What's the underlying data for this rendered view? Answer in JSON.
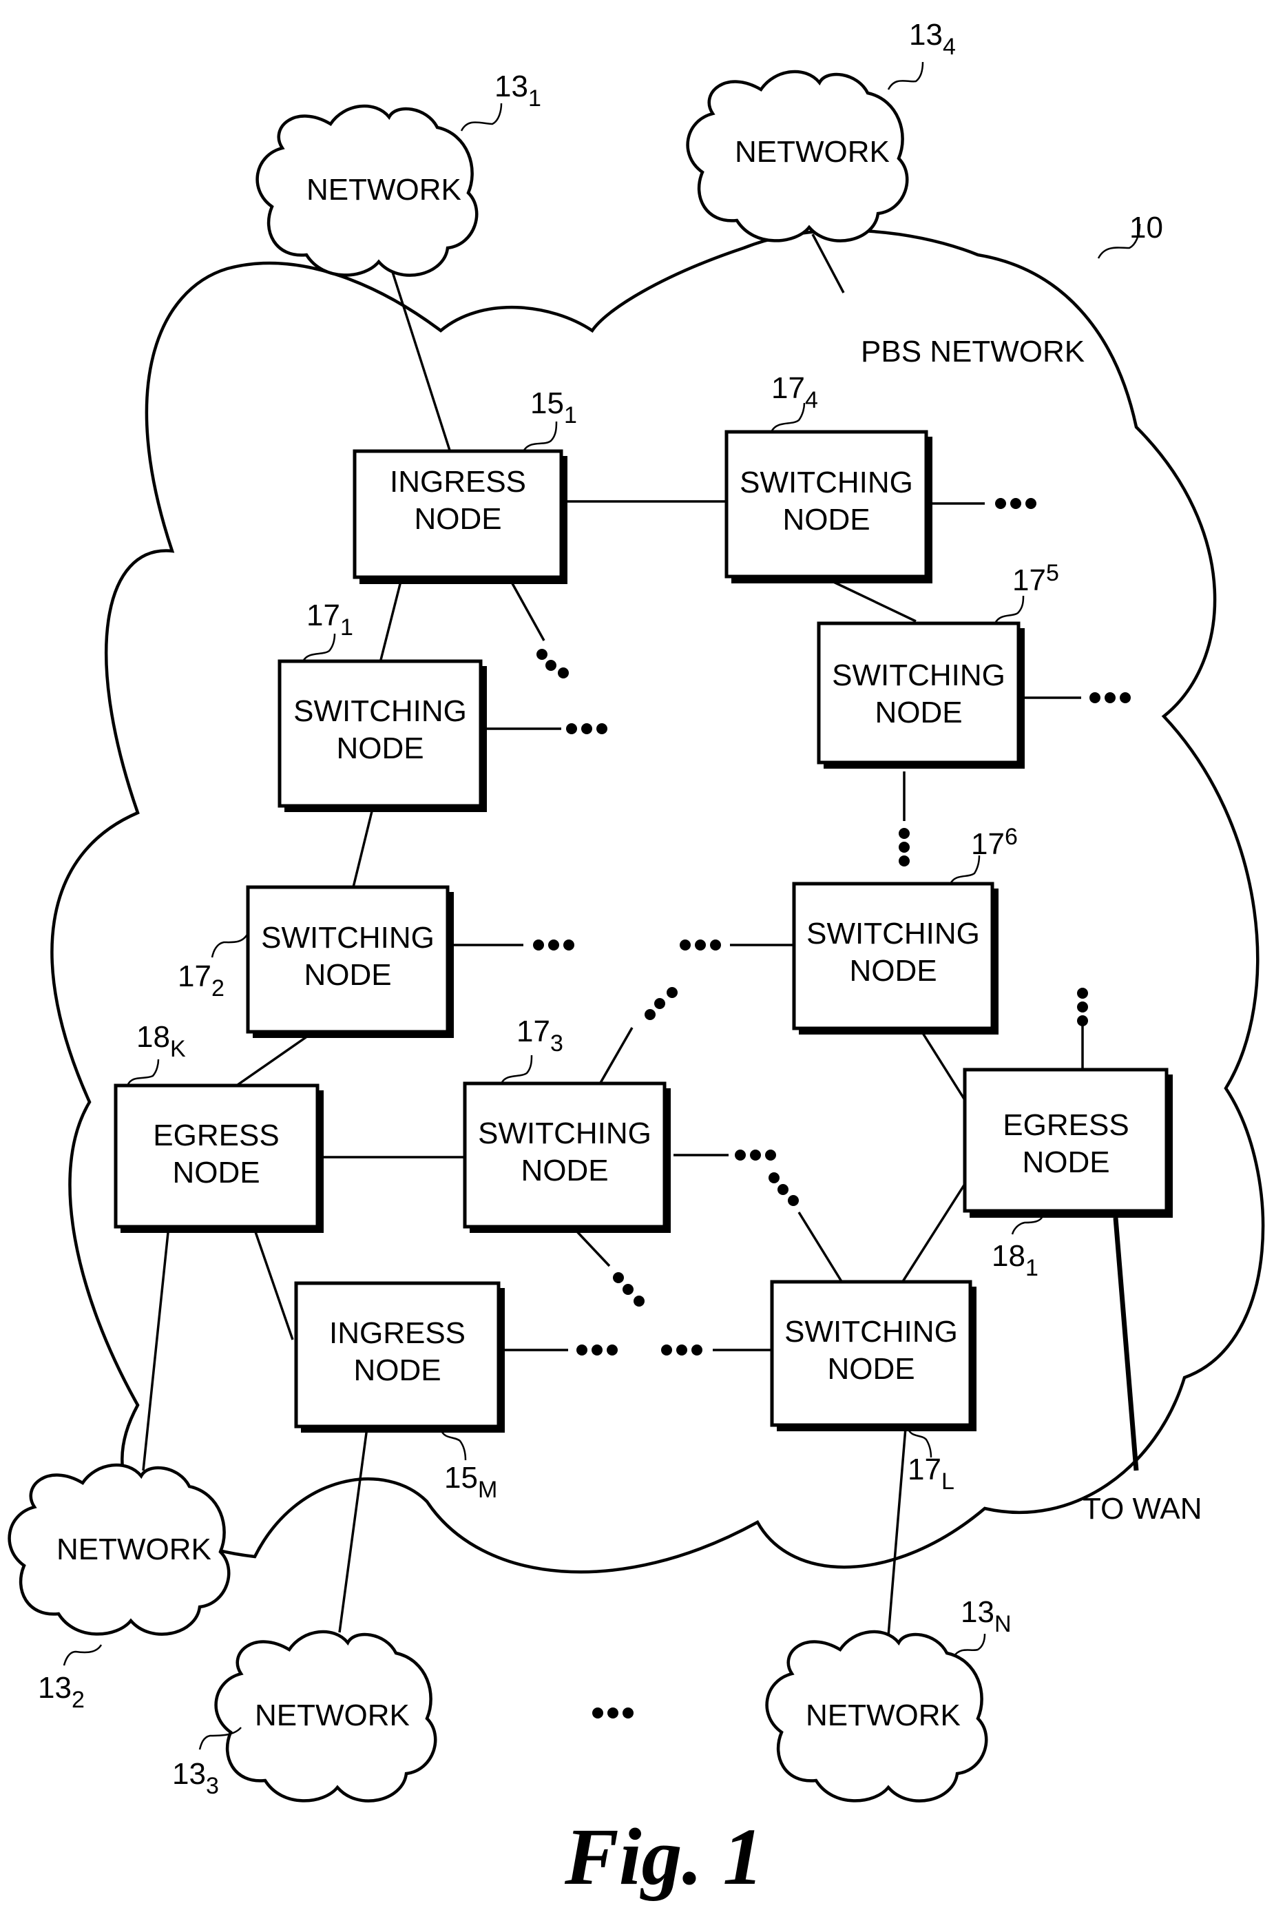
{
  "figure": {
    "caption": "Fig. 1",
    "main_network": {
      "label": "PBS NETWORK",
      "ref": "10"
    }
  },
  "external_networks": [
    {
      "id": "net-13-1",
      "label": "NETWORK",
      "ref_base": "13",
      "ref_sub": "1"
    },
    {
      "id": "net-13-2",
      "label": "NETWORK",
      "ref_base": "13",
      "ref_sub": "2"
    },
    {
      "id": "net-13-3",
      "label": "NETWORK",
      "ref_base": "13",
      "ref_sub": "3"
    },
    {
      "id": "net-13-4",
      "label": "NETWORK",
      "ref_base": "13",
      "ref_sub": "4"
    },
    {
      "id": "net-13-N",
      "label": "NETWORK",
      "ref_base": "13",
      "ref_sub": "N"
    }
  ],
  "nodes": [
    {
      "id": "ingress-15-1",
      "line1": "INGRESS",
      "line2": "NODE",
      "ref_base": "15",
      "ref_sub": "1"
    },
    {
      "id": "switch-17-4",
      "line1": "SWITCHING",
      "line2": "NODE",
      "ref_base": "17",
      "ref_sub": "4"
    },
    {
      "id": "switch-17-5",
      "line1": "SWITCHING",
      "line2": "NODE",
      "ref_base": "17",
      "ref_sub": "5"
    },
    {
      "id": "switch-17-1",
      "line1": "SWITCHING",
      "line2": "NODE",
      "ref_base": "17",
      "ref_sub": "1"
    },
    {
      "id": "switch-17-2",
      "line1": "SWITCHING",
      "line2": "NODE",
      "ref_base": "17",
      "ref_sub": "2"
    },
    {
      "id": "switch-17-6",
      "line1": "SWITCHING",
      "line2": "NODE",
      "ref_base": "17",
      "ref_sub": "6"
    },
    {
      "id": "egress-18-K",
      "line1": "EGRESS",
      "line2": "NODE",
      "ref_base": "18",
      "ref_sub": "K"
    },
    {
      "id": "switch-17-3",
      "line1": "SWITCHING",
      "line2": "NODE",
      "ref_base": "17",
      "ref_sub": "3"
    },
    {
      "id": "egress-18-1",
      "line1": "EGRESS",
      "line2": "NODE",
      "ref_base": "18",
      "ref_sub": "1"
    },
    {
      "id": "ingress-15-M",
      "line1": "INGRESS",
      "line2": "NODE",
      "ref_base": "15",
      "ref_sub": "M"
    },
    {
      "id": "switch-17-L",
      "line1": "SWITCHING",
      "line2": "NODE",
      "ref_base": "17",
      "ref_sub": "L"
    }
  ],
  "wan_link": {
    "label": "TO WAN"
  },
  "ellipsis": "•••"
}
